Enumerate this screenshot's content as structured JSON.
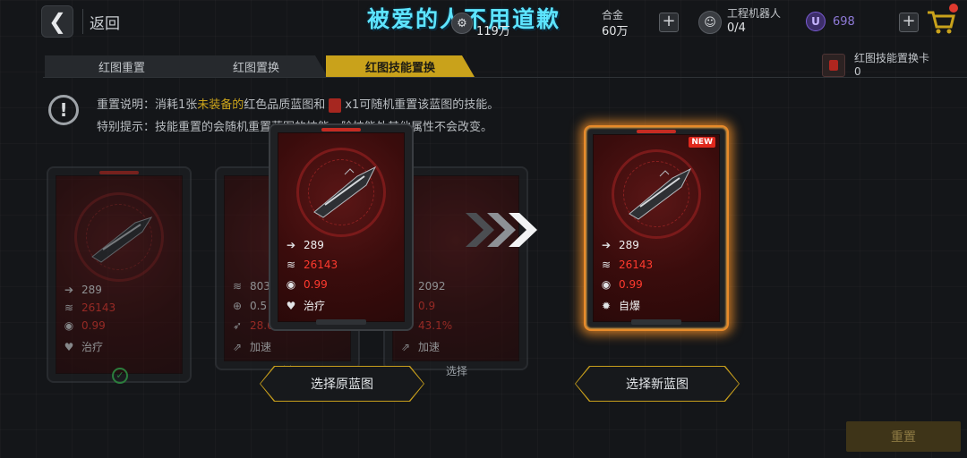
{
  "banner": "被爱的人不用道歉",
  "header": {
    "back_label": "返回",
    "resources": [
      {
        "icon": "gear-coin-icon",
        "label": "",
        "value": "119万"
      },
      {
        "icon": "alloy-icon",
        "label": "合金",
        "value": "60万"
      },
      {
        "icon": "robot-icon",
        "label": "工程机器人",
        "value": "0/4"
      },
      {
        "icon": "u-coin-icon",
        "label": "U",
        "value": "698"
      }
    ]
  },
  "tabs": [
    {
      "label": "红图重置",
      "active": false
    },
    {
      "label": "红图置换",
      "active": false
    },
    {
      "label": "红图技能置换",
      "active": true
    }
  ],
  "card_item": {
    "label": "红图技能置换卡",
    "count": "0"
  },
  "info": {
    "line1_pre": "重置说明：消耗1张",
    "line1_hl": "未装备的",
    "line1_mid": "红色品质蓝图和",
    "line1_post": "x1可随机重置该蓝图的技能。",
    "line2": "特别提示：技能重置的会随机重置蓝图的技能，除技能外其他属性不会改变。"
  },
  "bg_cards": [
    {
      "speed": "289",
      "power": "26143",
      "crit": "0.99",
      "skill": "治疗"
    },
    {
      "speed": "803",
      "power": "0.5",
      "crit": "28.6",
      "skill": "加速"
    },
    {
      "speed": "2092",
      "power": "0.9",
      "crit": "43.1%",
      "skill": "加速"
    }
  ],
  "bg_select_labels": [
    "选择",
    "选择"
  ],
  "original": {
    "speed": "289",
    "power": "26143",
    "crit": "0.99",
    "skill": "治疗"
  },
  "new_card": {
    "badge": "NEW",
    "speed": "289",
    "power": "26143",
    "crit": "0.99",
    "skill": "自爆"
  },
  "buttons": {
    "select_original": "选择原蓝图",
    "select_new": "选择新蓝图",
    "reset": "重置"
  },
  "colors": {
    "accent_gold": "#c9a21b",
    "stat_red": "#ff3a2e",
    "glow_orange": "#e88a2a"
  }
}
